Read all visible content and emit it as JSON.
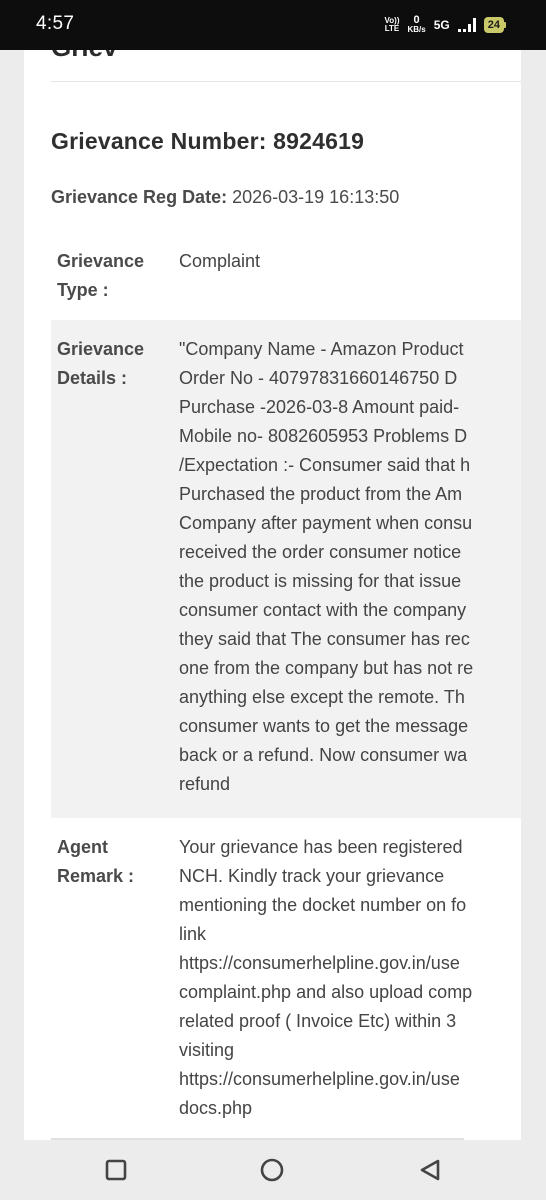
{
  "status_bar": {
    "time": "4:57",
    "volte_top": "Vo))",
    "volte_bottom": "LTE",
    "speed_value": "0",
    "speed_unit": "KB/s",
    "network": "5G",
    "battery": "24"
  },
  "page": {
    "prev_heading": "Griev",
    "grievance_number": "Grievance Number: 8924619",
    "reg_date_label": "Grievance Reg Date:",
    "reg_date_value": "2026-03-19 16:13:50"
  },
  "details": {
    "type": {
      "label_line1": "Grievance",
      "label_line2": "Type :",
      "value": "Complaint"
    },
    "grievance_details": {
      "label_line1": "Grievance",
      "label_line2": "Details :",
      "lines": [
        "\"Company Name - Amazon Product",
        "Order No - 40797831660146750 D",
        "Purchase -2026-03-8 Amount paid-",
        "Mobile no- 8082605953 Problems D",
        "/Expectation :- Consumer said that h",
        "Purchased the product from the Am",
        "Company after payment when consu",
        "received the order consumer notice",
        "the product is missing for that issue",
        "consumer contact with the company",
        "they said that The consumer has rec",
        "one from the company but has not re",
        "anything else except the remote. Th",
        "consumer wants to get the message",
        "back or a refund. Now consumer wa",
        "refund"
      ]
    },
    "agent_remark": {
      "label_line1": "Agent",
      "label_line2": "Remark :",
      "lines": [
        "Your grievance has been registered",
        "NCH. Kindly track your grievance",
        "mentioning the docket number on fo",
        "link",
        "https://consumerhelpline.gov.in/use",
        "complaint.php and also upload comp",
        "related proof ( Invoice Etc) within 3",
        "visiting",
        "https://consumerhelpline.gov.in/use",
        "docs.php"
      ]
    }
  },
  "nav": {
    "recents_icon": "square-recents-icon",
    "home_icon": "circle-home-icon",
    "back_icon": "triangle-back-icon"
  }
}
